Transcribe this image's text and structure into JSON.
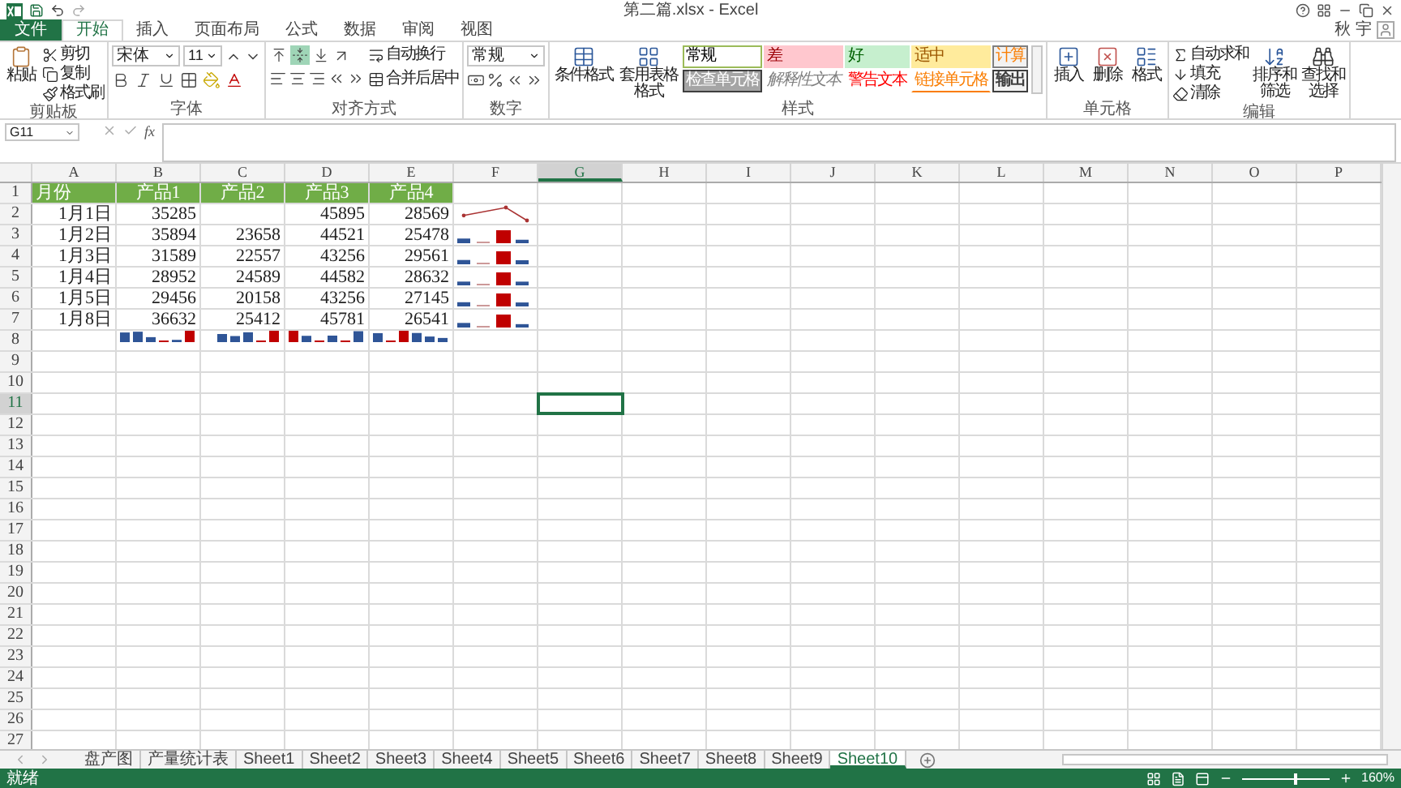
{
  "window": {
    "title": "第二篇.xlsx - Excel",
    "user": "秋 宇"
  },
  "ribbon_tabs": [
    {
      "label": "文件",
      "kind": "file",
      "selected": false
    },
    {
      "label": "开始",
      "kind": "tab",
      "selected": true
    },
    {
      "label": "插入",
      "kind": "tab",
      "selected": false
    },
    {
      "label": "页面布局",
      "kind": "tab",
      "selected": false
    },
    {
      "label": "公式",
      "kind": "tab",
      "selected": false
    },
    {
      "label": "数据",
      "kind": "tab",
      "selected": false
    },
    {
      "label": "审阅",
      "kind": "tab",
      "selected": false
    },
    {
      "label": "视图",
      "kind": "tab",
      "selected": false
    }
  ],
  "clipboard": {
    "paste": "粘贴",
    "cut": "剪切",
    "copy": "复制",
    "format_painter": "格式刷",
    "label": "剪贴板"
  },
  "font": {
    "name": "宋体",
    "size": "11",
    "label": "字体"
  },
  "alignment": {
    "vertical_buttons": [
      {
        "selected": false
      },
      {
        "selected": true
      },
      {
        "selected": false
      }
    ],
    "wrap": "自动换行",
    "merge": "合并后居中",
    "label": "对齐方式"
  },
  "number": {
    "format": "常规",
    "label": "数字"
  },
  "styles": {
    "conditional": "条件格式",
    "table_format": "套用表格格式",
    "label": "样式",
    "gallery": [
      {
        "label": "常规",
        "kind": "normal"
      },
      {
        "label": "差",
        "kind": "bad"
      },
      {
        "label": "好",
        "kind": "good"
      },
      {
        "label": "适中",
        "kind": "neutral"
      },
      {
        "label": "计算",
        "kind": "calculation"
      },
      {
        "label": "检查单元格",
        "kind": "check"
      },
      {
        "label": "解释性文本",
        "kind": "explanatory"
      },
      {
        "label": "警告文本",
        "kind": "warning"
      },
      {
        "label": "链接单元格",
        "kind": "linked"
      },
      {
        "label": "输出",
        "kind": "output"
      }
    ]
  },
  "cells_group": {
    "insert": "插入",
    "delete": "删除",
    "format": "格式",
    "label": "单元格"
  },
  "editing": {
    "autosum": "自动求和",
    "fill": "填充",
    "clear": "清除",
    "sort": "排序和筛选",
    "find": "查找和选择",
    "label": "编辑"
  },
  "formula_bar": {
    "name_box": "G11",
    "fx": "fx"
  },
  "sheet": {
    "columns": [
      {
        "letter": "A",
        "selected": false
      },
      {
        "letter": "B",
        "selected": false
      },
      {
        "letter": "C",
        "selected": false
      },
      {
        "letter": "D",
        "selected": false
      },
      {
        "letter": "E",
        "selected": false
      },
      {
        "letter": "F",
        "selected": false
      },
      {
        "letter": "G",
        "selected": true
      },
      {
        "letter": "H",
        "selected": false
      },
      {
        "letter": "I",
        "selected": false
      },
      {
        "letter": "J",
        "selected": false
      },
      {
        "letter": "K",
        "selected": false
      },
      {
        "letter": "L",
        "selected": false
      },
      {
        "letter": "M",
        "selected": false
      },
      {
        "letter": "N",
        "selected": false
      },
      {
        "letter": "O",
        "selected": false
      },
      {
        "letter": "P",
        "selected": false
      }
    ],
    "rows": [
      {
        "number": "1",
        "selected": false,
        "kind": "header",
        "cells": [
          "月份",
          "产品1",
          "产品2",
          "产品3",
          "产品4"
        ]
      },
      {
        "number": "2",
        "selected": false,
        "kind": "data",
        "sparkline": {
          "kind": "line"
        },
        "cells": [
          "1月1日",
          "35285",
          null,
          "45895",
          "28569"
        ]
      },
      {
        "number": "3",
        "selected": false,
        "kind": "data",
        "sparkline": {
          "kind": "column"
        },
        "cells": [
          "1月2日",
          "35894",
          "23658",
          "44521",
          "25478"
        ]
      },
      {
        "number": "4",
        "selected": false,
        "kind": "data",
        "sparkline": {
          "kind": "column"
        },
        "cells": [
          "1月3日",
          "31589",
          "22557",
          "43256",
          "29561"
        ]
      },
      {
        "number": "5",
        "selected": false,
        "kind": "data",
        "sparkline": {
          "kind": "column"
        },
        "cells": [
          "1月4日",
          "28952",
          "24589",
          "44582",
          "28632"
        ]
      },
      {
        "number": "6",
        "selected": false,
        "kind": "data",
        "sparkline": {
          "kind": "column"
        },
        "cells": [
          "1月5日",
          "29456",
          "20158",
          "43256",
          "27145"
        ]
      },
      {
        "number": "7",
        "selected": false,
        "kind": "data",
        "sparkline": {
          "kind": "column"
        },
        "cells": [
          "1月8日",
          "36632",
          "25412",
          "45781",
          "26541"
        ]
      },
      {
        "number": "8",
        "selected": false,
        "kind": "summary"
      },
      {
        "number": "9",
        "selected": false,
        "kind": "empty"
      },
      {
        "number": "10",
        "selected": false,
        "kind": "empty"
      },
      {
        "number": "11",
        "selected": true,
        "kind": "empty"
      },
      {
        "number": "12",
        "selected": false,
        "kind": "empty"
      },
      {
        "number": "13",
        "selected": false,
        "kind": "empty"
      },
      {
        "number": "14",
        "selected": false,
        "kind": "empty"
      },
      {
        "number": "15",
        "selected": false,
        "kind": "empty"
      },
      {
        "number": "16",
        "selected": false,
        "kind": "empty"
      },
      {
        "number": "17",
        "selected": false,
        "kind": "empty"
      },
      {
        "number": "18",
        "selected": false,
        "kind": "empty"
      },
      {
        "number": "19",
        "selected": false,
        "kind": "empty"
      },
      {
        "number": "20",
        "selected": false,
        "kind": "empty"
      },
      {
        "number": "21",
        "selected": false,
        "kind": "empty"
      },
      {
        "number": "22",
        "selected": false,
        "kind": "empty"
      },
      {
        "number": "23",
        "selected": false,
        "kind": "empty"
      },
      {
        "number": "24",
        "selected": false,
        "kind": "empty"
      },
      {
        "number": "25",
        "selected": false,
        "kind": "empty"
      },
      {
        "number": "26",
        "selected": false,
        "kind": "empty"
      },
      {
        "number": "27",
        "selected": false,
        "kind": "empty"
      }
    ]
  },
  "sheet_tabs": [
    {
      "label": "盘产图",
      "selected": false
    },
    {
      "label": "产量统计表",
      "selected": false
    },
    {
      "label": "Sheet1",
      "selected": false
    },
    {
      "label": "Sheet2",
      "selected": false
    },
    {
      "label": "Sheet3",
      "selected": false
    },
    {
      "label": "Sheet4",
      "selected": false
    },
    {
      "label": "Sheet5",
      "selected": false
    },
    {
      "label": "Sheet6",
      "selected": false
    },
    {
      "label": "Sheet7",
      "selected": false
    },
    {
      "label": "Sheet8",
      "selected": false
    },
    {
      "label": "Sheet9",
      "selected": false
    },
    {
      "label": "Sheet10",
      "selected": true
    }
  ],
  "status_bar": {
    "status": "就绪",
    "zoom": "160%",
    "zoom_slider": {
      "level": 0.6
    }
  }
}
